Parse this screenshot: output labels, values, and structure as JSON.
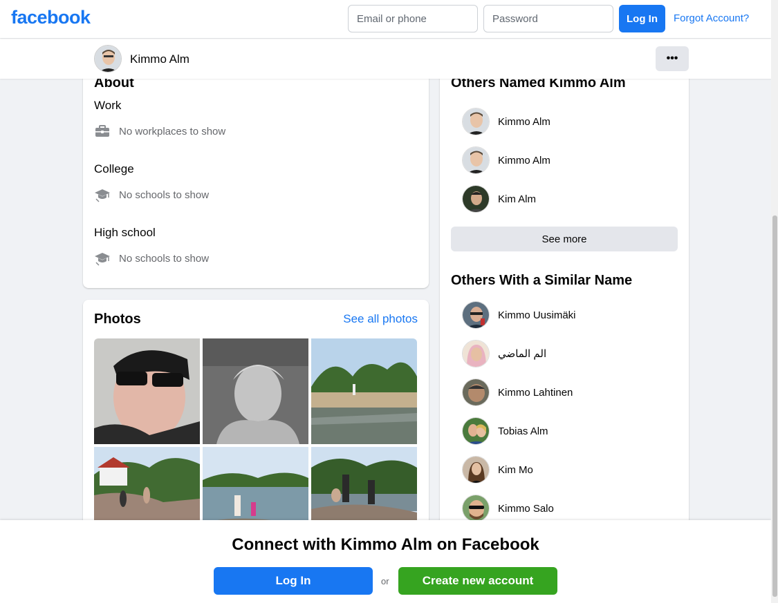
{
  "header": {
    "logo": "facebook",
    "email_placeholder": "Email or phone",
    "password_placeholder": "Password",
    "login_label": "Log In",
    "forgot_label": "Forgot Account?"
  },
  "profile": {
    "name": "Kimmo Alm",
    "more_label": "•••"
  },
  "about": {
    "title": "About",
    "work_label": "Work",
    "work_value": "No workplaces to show",
    "college_label": "College",
    "college_value": "No schools to show",
    "highschool_label": "High school",
    "highschool_value": "No schools to show"
  },
  "photos": {
    "title": "Photos",
    "see_all": "See all photos"
  },
  "others_named": {
    "title": "Others Named Kimmo Alm",
    "people": [
      "Kimmo Alm",
      "Kimmo Alm",
      "Kim Alm"
    ],
    "see_more": "See more"
  },
  "similar": {
    "title": "Others With a Similar Name",
    "people": [
      "Kimmo Uusimäki",
      "الم الماضي",
      "Kimmo Lahtinen",
      "Tobias Alm",
      "Kim Mo",
      "Kimmo Salo"
    ]
  },
  "connect": {
    "title": "Connect with Kimmo Alm on Facebook",
    "login_label": "Log In",
    "or_label": "or",
    "create_label": "Create new account"
  },
  "colors": {
    "brand": "#1877f2",
    "create_green": "#36a420",
    "background": "#f0f2f5"
  }
}
